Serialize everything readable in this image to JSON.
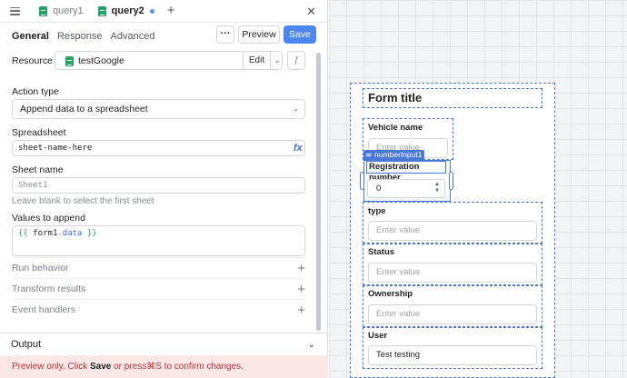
{
  "tabs": [
    {
      "label": "query1"
    },
    {
      "label": "query2"
    }
  ],
  "icons": {
    "list": "list-icon",
    "add_tab": "+",
    "close": "✕",
    "more": "···",
    "fx": "fx",
    "chevron_down": "⌄",
    "add_row": "+"
  },
  "subtabs": [
    "General",
    "Response",
    "Advanced"
  ],
  "toolbar": {
    "preview_label": "Preview",
    "save_label": "Save"
  },
  "resource": {
    "label": "Resource",
    "name": "testGoogle",
    "edit_label": "Edit",
    "fx_label": "ƒ"
  },
  "action_type": {
    "label": "Action type",
    "value": "Append data to a spreadsheet"
  },
  "spreadsheet": {
    "label": "Spreadsheet",
    "value": "sheet-name-here",
    "fx": "fx"
  },
  "sheet_name": {
    "label": "Sheet name",
    "placeholder": "Sheet1",
    "hint": "Leave blank to select the first sheet"
  },
  "values": {
    "label": "Values to append",
    "open": "{{",
    "obj": "form1",
    "dot": ".",
    "prop": "data",
    "close": "}}"
  },
  "sections": [
    "Run behavior",
    "Transform results",
    "Event handlers"
  ],
  "output": {
    "label": "Output"
  },
  "preview_notice": {
    "prefix": "Preview only.",
    "click": "Click",
    "save": "Save",
    "middle": "or press",
    "shortcut": "⌘S",
    "suffix": "to confirm changes."
  },
  "form": {
    "title": "Form title",
    "tag": "numberInput1",
    "fields": [
      {
        "label": "Vehicle name",
        "placeholder": "Enter value"
      },
      {
        "label": "Registration number",
        "value": "0"
      },
      {
        "label": "type",
        "placeholder": "Enter value"
      },
      {
        "label": "Status",
        "placeholder": "Enter value"
      },
      {
        "label": "Ownership",
        "placeholder": "Enter value"
      },
      {
        "label": "User",
        "value": "Test testing"
      }
    ]
  },
  "colors": {
    "accent": "#4d86ee",
    "sheets_green": "#21a464",
    "error_text": "#b53434",
    "error_bg": "#fbe6e6"
  }
}
